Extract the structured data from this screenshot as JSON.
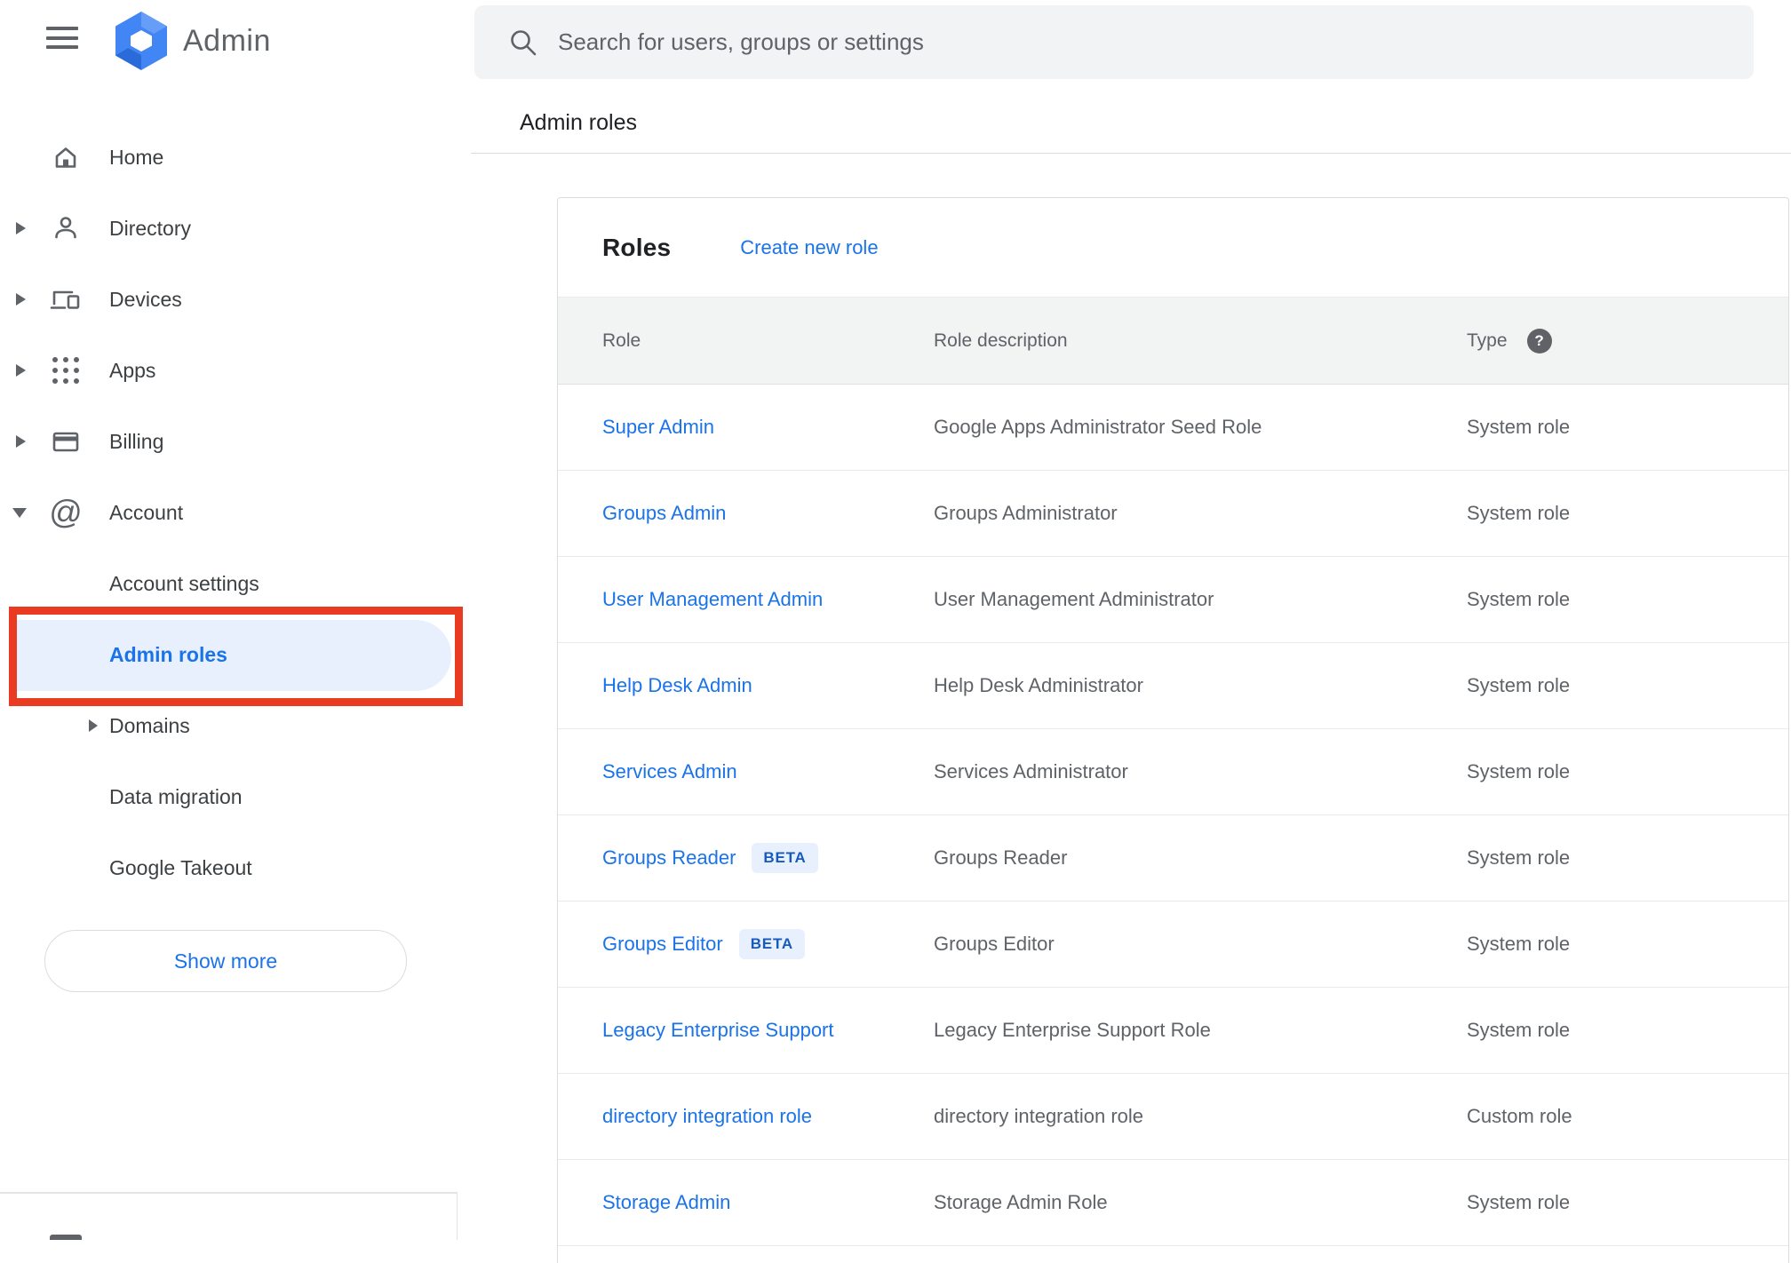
{
  "app": {
    "title": "Admin"
  },
  "topbar": {
    "search_placeholder": "Search for users, groups or settings"
  },
  "breadcrumb": "Admin roles",
  "sidebar": {
    "items": [
      {
        "label": "Home",
        "icon": "home-icon",
        "expandable": false
      },
      {
        "label": "Directory",
        "icon": "person-icon",
        "expandable": true
      },
      {
        "label": "Devices",
        "icon": "devices-icon",
        "expandable": true
      },
      {
        "label": "Apps",
        "icon": "apps-grid-icon",
        "expandable": true
      },
      {
        "label": "Billing",
        "icon": "credit-card-icon",
        "expandable": true
      },
      {
        "label": "Account",
        "icon": "at-sign-icon",
        "expandable": true,
        "expanded": true
      }
    ],
    "account_children": [
      {
        "label": "Account settings",
        "selected": false
      },
      {
        "label": "Admin roles",
        "selected": true,
        "annotated": true
      },
      {
        "label": "Domains",
        "expandable": true
      },
      {
        "label": "Data migration"
      },
      {
        "label": "Google Takeout"
      }
    ],
    "show_more_label": "Show more"
  },
  "main": {
    "card": {
      "title": "Roles",
      "create_link": "Create new role",
      "columns": [
        "Role",
        "Role description",
        "Type"
      ],
      "type_help_icon": "?",
      "beta_label": "BETA",
      "rows": [
        {
          "role": "Super Admin",
          "beta": false,
          "description": "Google Apps Administrator Seed Role",
          "type": "System role"
        },
        {
          "role": "Groups Admin",
          "beta": false,
          "description": "Groups Administrator",
          "type": "System role"
        },
        {
          "role": "User Management Admin",
          "beta": false,
          "description": "User Management Administrator",
          "type": "System role"
        },
        {
          "role": "Help Desk Admin",
          "beta": false,
          "description": "Help Desk Administrator",
          "type": "System role"
        },
        {
          "role": "Services Admin",
          "beta": false,
          "description": "Services Administrator",
          "type": "System role"
        },
        {
          "role": "Groups Reader",
          "beta": true,
          "description": "Groups Reader",
          "type": "System role"
        },
        {
          "role": "Groups Editor",
          "beta": true,
          "description": "Groups Editor",
          "type": "System role"
        },
        {
          "role": "Legacy Enterprise Support",
          "beta": false,
          "description": "Legacy Enterprise Support Role",
          "type": "System role"
        },
        {
          "role": "directory integration role",
          "beta": false,
          "description": "directory integration role",
          "type": "Custom role"
        },
        {
          "role": "Storage Admin",
          "beta": false,
          "description": "Storage Admin Role",
          "type": "System role"
        }
      ]
    }
  },
  "colors": {
    "accent_blue": "#1a73e8",
    "selected_bg": "#e8f0fe",
    "annotation_red": "#e83b21",
    "beta_badge_bg": "#e8f0fe",
    "beta_badge_text": "#185abc",
    "search_bg": "#f1f3f4",
    "table_head_bg": "#f2f3f3",
    "icon_gray": "#5f6368",
    "text_dark": "#202124",
    "text_secondary": "#5f6368",
    "divider": "#dadce0"
  }
}
